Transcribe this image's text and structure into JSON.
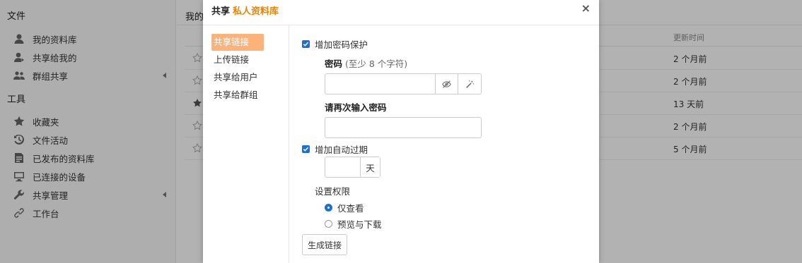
{
  "sidebar": {
    "files_heading": "文件",
    "files_items": [
      {
        "label": "我的资料库",
        "icon": "user-icon"
      },
      {
        "label": "共享给我的",
        "icon": "user-share-icon"
      },
      {
        "label": "群组共享",
        "icon": "group-icon"
      }
    ],
    "tools_heading": "工具",
    "tools_items": [
      {
        "label": "收藏夹",
        "icon": "star-icon"
      },
      {
        "label": "文件活动",
        "icon": "history-icon"
      },
      {
        "label": "已发布的资料库",
        "icon": "publish-icon"
      },
      {
        "label": "已连接的设备",
        "icon": "monitor-icon"
      },
      {
        "label": "共享管理",
        "icon": "wrench-icon"
      },
      {
        "label": "工作台",
        "icon": "link-icon"
      }
    ]
  },
  "main": {
    "title": "我的",
    "mtime_header": "更新时间",
    "rows": [
      {
        "starred": false,
        "mtime": "2 个月前"
      },
      {
        "starred": false,
        "mtime": "2 个月前"
      },
      {
        "starred": true,
        "mtime": "13 天前"
      },
      {
        "starred": false,
        "mtime": "2 个月前"
      },
      {
        "starred": false,
        "mtime": "5 个月前"
      }
    ]
  },
  "modal": {
    "title_prefix": "共享",
    "repo_name": "私人资料库",
    "close": "×",
    "nav": [
      {
        "label": "共享链接",
        "active": true
      },
      {
        "label": "上传链接",
        "active": false
      },
      {
        "label": "共享给用户",
        "active": false
      },
      {
        "label": "共享给群组",
        "active": false
      }
    ],
    "password_protect_label": "增加密码保护",
    "password_label": "密码",
    "password_hint": "(至少 8 个字符)",
    "password_value": "",
    "confirm_label": "请再次输入密码",
    "confirm_value": "",
    "expire_label": "增加自动过期",
    "days_value": "",
    "days_unit": "天",
    "permission_label": "设置权限",
    "permissions": [
      {
        "label": "仅查看",
        "selected": true
      },
      {
        "label": "预览与下载",
        "selected": false
      }
    ],
    "generate_button": "生成链接"
  },
  "colors": {
    "accent_orange": "#eb8205",
    "nav_active_bg": "#fdb27a",
    "checkbox_blue": "#1f6fd0"
  }
}
